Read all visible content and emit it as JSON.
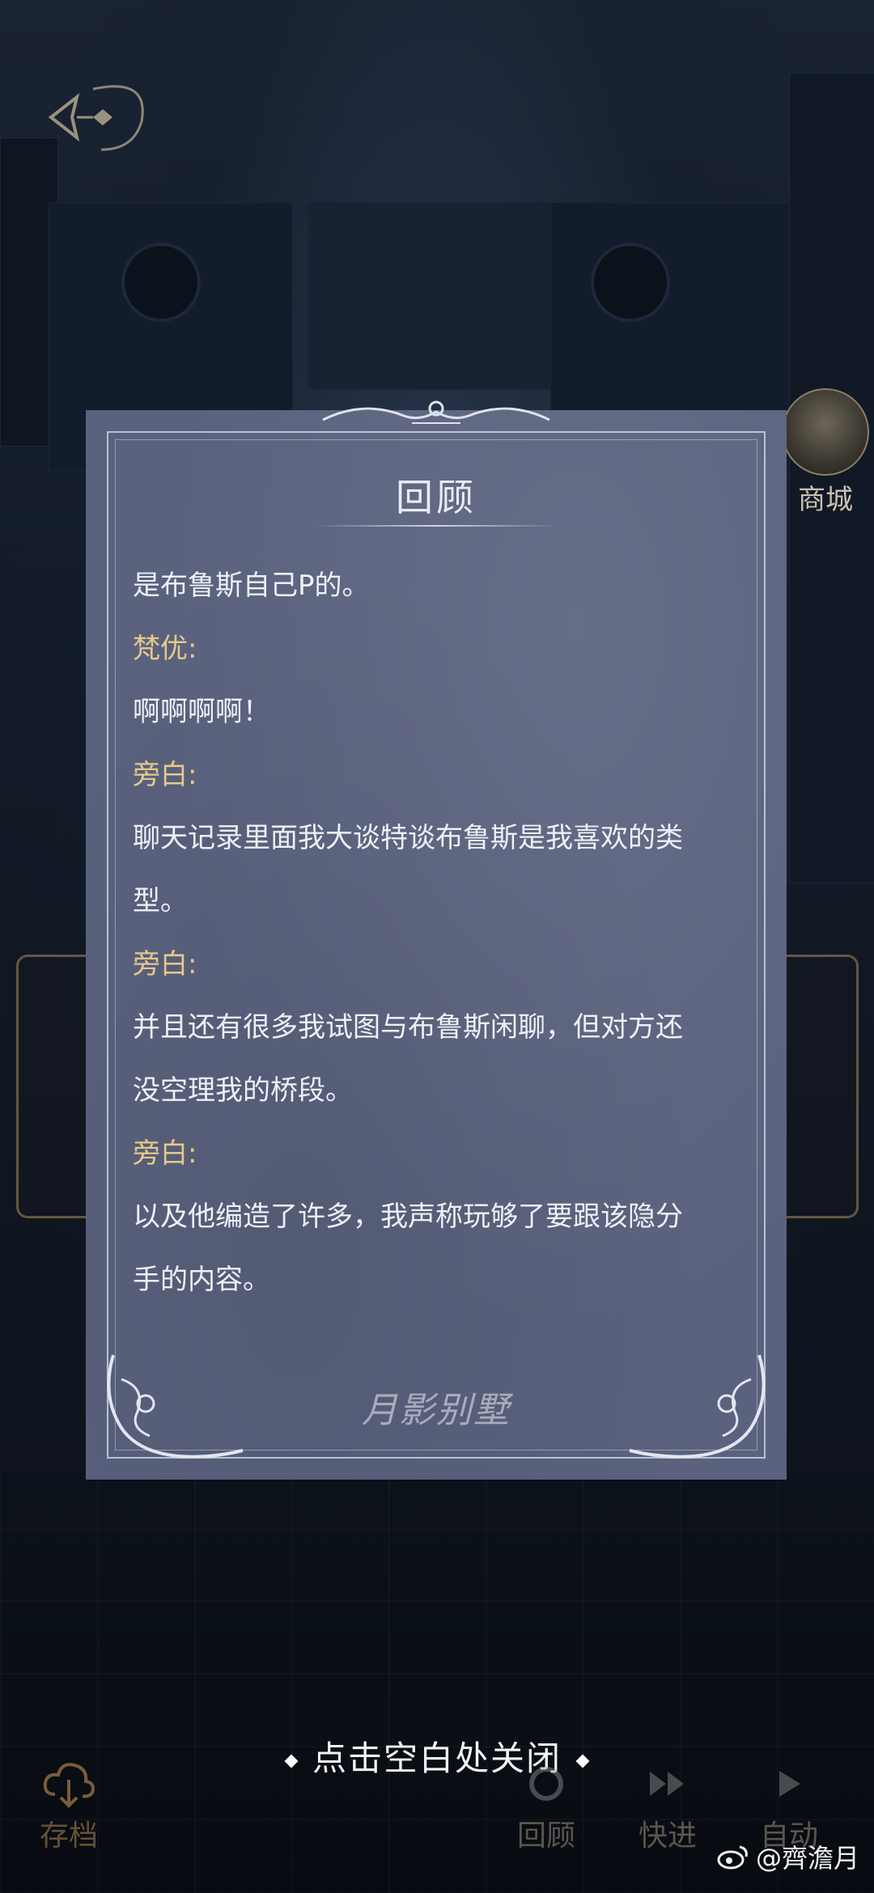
{
  "panel": {
    "title": "回顾",
    "entries": [
      {
        "type": "line",
        "text": "是布鲁斯自己P的。"
      },
      {
        "type": "speaker",
        "text": "梵优:"
      },
      {
        "type": "line",
        "text": "啊啊啊啊！"
      },
      {
        "type": "speaker",
        "text": "旁白:"
      },
      {
        "type": "line",
        "text": "聊天记录里面我大谈特谈布鲁斯是我喜欢的类"
      },
      {
        "type": "line",
        "text": "型。"
      },
      {
        "type": "speaker",
        "text": "旁白:"
      },
      {
        "type": "line",
        "text": "并且还有很多我试图与布鲁斯闲聊，但对方还"
      },
      {
        "type": "line",
        "text": "没空理我的桥段。"
      },
      {
        "type": "speaker",
        "text": "旁白:"
      },
      {
        "type": "line",
        "text": "以及他编造了许多，我声称玩够了要跟该隐分"
      },
      {
        "type": "line",
        "text": "手的内容。"
      }
    ],
    "logo_text": "月影别墅"
  },
  "shop": {
    "label": "商城"
  },
  "close_hint": "点击空白处关闭",
  "toolbar": {
    "save": "存档",
    "review": "回顾",
    "skip": "快进",
    "auto": "自动"
  },
  "watermark": "@齊澹月",
  "colors": {
    "panel_bg": "#5a627e",
    "speaker": "#e6c98a",
    "text": "#eef0f7"
  }
}
